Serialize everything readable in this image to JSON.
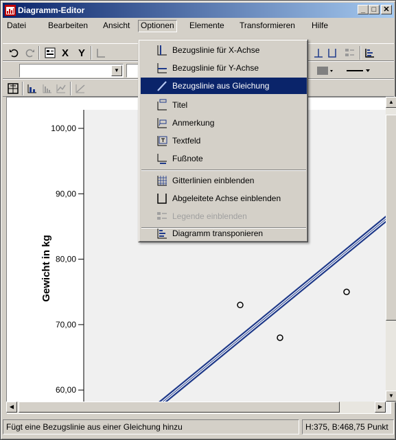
{
  "window": {
    "title": "Diagramm-Editor",
    "controls": [
      "_",
      "□",
      "✕"
    ]
  },
  "menubar": {
    "items": [
      "Datei",
      "Bearbeiten",
      "Ansicht",
      "Optionen",
      "Elemente",
      "Transformieren",
      "Hilfe"
    ],
    "open_menu": "Optionen"
  },
  "toolbar1": {
    "x_label": "X",
    "y_label": "Y"
  },
  "chart": {
    "ylabel": "Gewicht in kg",
    "y_ticks": [
      "100,00",
      "90,00",
      "80,00",
      "70,00",
      "60,00"
    ]
  },
  "chart_data": {
    "type": "scatter",
    "ylabel": "Gewicht in kg",
    "y_ticks": [
      100,
      90,
      80,
      70,
      60
    ],
    "series": [
      {
        "points_y": [
          73,
          68,
          75
        ]
      }
    ],
    "reference_line": "linear (from equation)",
    "grid": false
  },
  "dropdown": {
    "items": [
      {
        "label": "Bezugslinie für X-Achse",
        "icon": "x-axis-refline-icon",
        "highlighted": false,
        "disabled": false
      },
      {
        "label": "Bezugslinie für Y-Achse",
        "icon": "y-axis-refline-icon",
        "highlighted": false,
        "disabled": false
      },
      {
        "label": "Bezugslinie aus Gleichung",
        "icon": "equation-refline-icon",
        "highlighted": true,
        "disabled": false
      },
      {
        "label": "Titel",
        "icon": "title-icon",
        "highlighted": false,
        "disabled": false
      },
      {
        "label": "Anmerkung",
        "icon": "annotation-icon",
        "highlighted": false,
        "disabled": false
      },
      {
        "label": "Textfeld",
        "icon": "textbox-icon",
        "highlighted": false,
        "disabled": false
      },
      {
        "label": "Fußnote",
        "icon": "footnote-icon",
        "highlighted": false,
        "disabled": false
      },
      {
        "label": "Gitterlinien einblenden",
        "icon": "gridlines-icon",
        "highlighted": false,
        "disabled": false
      },
      {
        "label": "Abgeleitete Achse einblenden",
        "icon": "derived-axis-icon",
        "highlighted": false,
        "disabled": false
      },
      {
        "label": "Legende einblenden",
        "icon": "legend-icon",
        "highlighted": false,
        "disabled": true
      },
      {
        "label": "Diagramm transponieren",
        "icon": "transpose-icon",
        "highlighted": false,
        "disabled": false
      }
    ]
  },
  "status": {
    "message": "Fügt eine Bezugslinie aus einer Gleichung hinzu",
    "dimensions": "H:375, B:468,75 Punkt"
  },
  "colors": {
    "highlight": "#0a246a",
    "refline": "#1f3a8a",
    "titlebar": "#0a246a"
  }
}
